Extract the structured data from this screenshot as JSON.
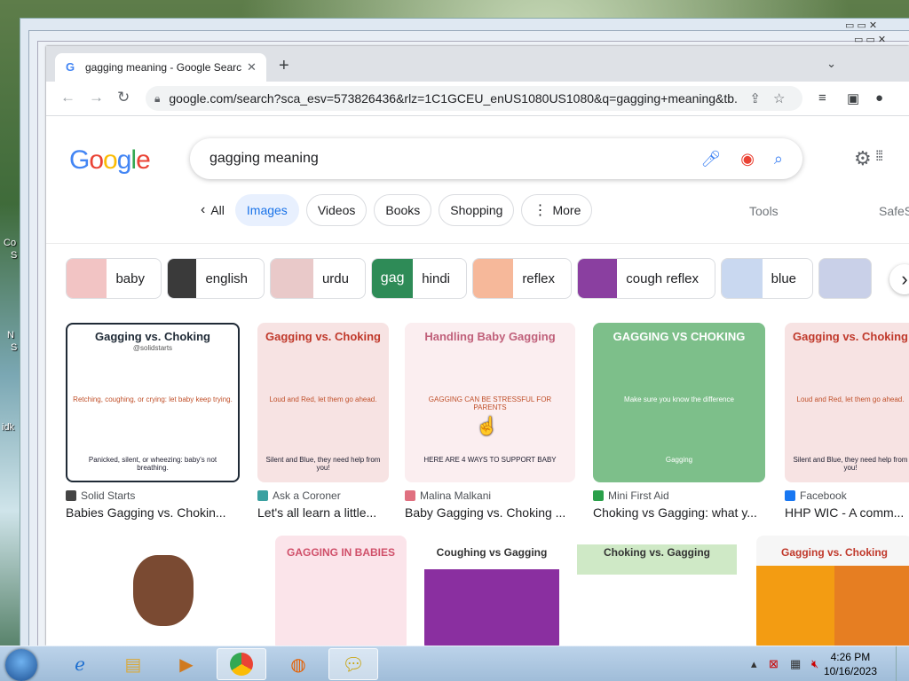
{
  "desktop": {
    "labels": [
      "Co",
      "S",
      "N",
      "S",
      "idk"
    ]
  },
  "browser": {
    "tab_title": "gagging meaning - Google Search",
    "tab_favicon": "G",
    "new_tab": "+",
    "url": "google.com/search?sca_esv=573826436&rlz=1C1GCEU_enUS1080US1080&q=gagging+meaning&tb..."
  },
  "search": {
    "logo": [
      "G",
      "o",
      "o",
      "g",
      "l",
      "e"
    ],
    "logo_colors": [
      "#4285f4",
      "#ea4335",
      "#fbbc05",
      "#4285f4",
      "#34a853",
      "#ea4335"
    ],
    "query": "gagging meaning",
    "filters": [
      {
        "label": "All",
        "prefix": "‹"
      },
      {
        "label": "Images",
        "active": true
      },
      {
        "label": "Videos"
      },
      {
        "label": "Books"
      },
      {
        "label": "Shopping"
      },
      {
        "label": "More",
        "prefix": "⋮"
      }
    ],
    "tools": "Tools",
    "safesearch": "SafeS"
  },
  "related": [
    {
      "label": "baby",
      "color": "#f2c4c4"
    },
    {
      "label": "english",
      "color": "#3a3a3a"
    },
    {
      "label": "urdu",
      "color": "#e9c9c9"
    },
    {
      "label": "hindi",
      "color": "#2e8b57",
      "thumb_text": "gag"
    },
    {
      "label": "reflex",
      "color": "#f6b89a"
    },
    {
      "label": "cough reflex",
      "color": "#8a3fa0"
    },
    {
      "label": "blue",
      "color": "#c9d8f0"
    }
  ],
  "results": [
    {
      "source": "Solid Starts",
      "title": "Babies Gagging vs. Chokin...",
      "fav_color": "#444",
      "img_heading": "Gagging vs. Choking",
      "img_sub": "@solidstarts",
      "img_caption1": "Retching, coughing, or crying: let baby keep trying.",
      "img_caption2": "Panicked, silent, or wheezing: baby's not breathing."
    },
    {
      "source": "Ask a Coroner",
      "title": "Let's all learn a little...",
      "fav_color": "#3aa0a0",
      "img_heading": "Gagging vs. Choking",
      "img_caption1": "Loud and Red, let them go ahead.",
      "img_caption2": "Silent and Blue, they need help from you!"
    },
    {
      "source": "Malina Malkani",
      "title": "Baby Gagging vs. Choking ...",
      "fav_color": "#e07080",
      "img_heading": "Handling Baby Gagging",
      "img_caption1": "GAGGING CAN BE STRESSFUL FOR PARENTS",
      "img_caption2": "HERE ARE 4 WAYS TO SUPPORT BABY"
    },
    {
      "source": "Mini First Aid",
      "title": "Choking vs Gagging: what y...",
      "fav_color": "#2aa04a",
      "img_heading": "GAGGING VS CHOKING",
      "img_caption1": "Make sure you know the difference",
      "img_caption2": "Gagging"
    },
    {
      "source": "Facebook",
      "title": "HHP WIC - A comm...",
      "fav_color": "#1877f2",
      "img_heading": "Gagging vs. Choking",
      "img_caption1": "Loud and Red, let them go ahead.",
      "img_caption2": "Silent and Blue, they need help from you!"
    }
  ],
  "row2": [
    {
      "caption": ""
    },
    {
      "caption": "GAGGING IN BABIES"
    },
    {
      "caption": "Coughing vs Gagging"
    },
    {
      "caption": "Choking vs. Gagging"
    },
    {
      "caption": "Gagging vs. Choking"
    }
  ],
  "taskbar": {
    "time": "4:26 PM",
    "date": "10/16/2023"
  }
}
